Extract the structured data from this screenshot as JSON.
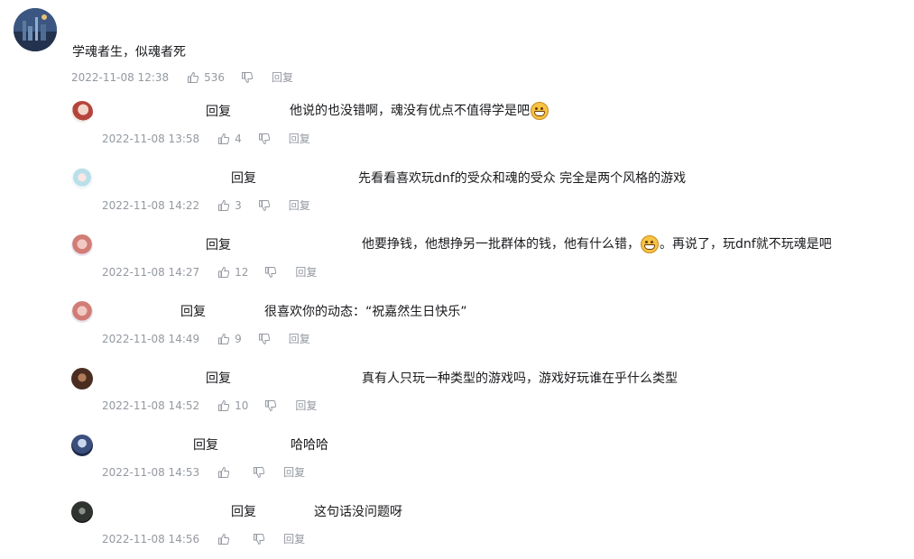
{
  "main_comment": {
    "text": "学魂者生，似魂者死",
    "time": "2022-11-08 12:38",
    "likes": "536",
    "reply_label": "回复"
  },
  "replies": [
    {
      "reply_label": "回复",
      "text_before": "他说的也没错啊，魂没有优点不值得学是吧",
      "emoji": "grinning-emoji",
      "text_after": "",
      "time": "2022-11-08 13:58",
      "likes": "4",
      "action_label": "回复"
    },
    {
      "reply_label": "回复",
      "text_before": "先看看喜欢玩dnf的受众和魂的受众  完全是两个风格的游戏",
      "emoji": "",
      "text_after": "",
      "time": "2022-11-08 14:22",
      "likes": "3",
      "action_label": "回复"
    },
    {
      "reply_label": "回复",
      "text_before": "他要挣钱，他想挣另一批群体的钱，他有什么错，",
      "emoji": "grinning-emoji",
      "text_after": "。再说了，玩dnf就不玩魂是吧",
      "time": "2022-11-08 14:27",
      "likes": "12",
      "action_label": "回复"
    },
    {
      "reply_label": "回复",
      "text_before": "很喜欢你的动态：“祝嘉然生日快乐”",
      "emoji": "",
      "text_after": "",
      "time": "2022-11-08 14:49",
      "likes": "9",
      "action_label": "回复"
    },
    {
      "reply_label": "回复",
      "text_before": "真有人只玩一种类型的游戏吗，游戏好玩谁在乎什么类型",
      "emoji": "",
      "text_after": "",
      "time": "2022-11-08 14:52",
      "likes": "10",
      "action_label": "回复"
    },
    {
      "reply_label": "回复",
      "text_before": "哈哈哈",
      "emoji": "",
      "text_after": "",
      "time": "2022-11-08 14:53",
      "likes": "",
      "action_label": "回复"
    },
    {
      "reply_label": "回复",
      "text_before": "这句话没问题呀",
      "emoji": "",
      "text_after": "",
      "time": "2022-11-08 14:56",
      "likes": "",
      "action_label": "回复"
    }
  ],
  "icons": {
    "like": "thumb-up-icon",
    "dislike": "thumb-down-icon"
  },
  "colors": {
    "text": "#18191c",
    "meta": "#9499a0"
  }
}
